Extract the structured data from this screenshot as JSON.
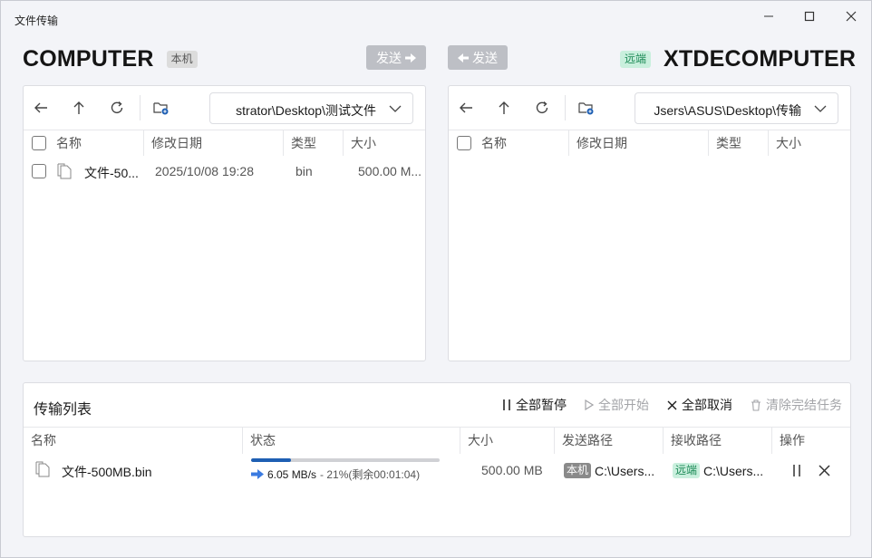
{
  "window": {
    "title": "文件传输"
  },
  "local": {
    "machine_name": "COMPUTER",
    "badge": "本机",
    "send_button": "发送",
    "path": "strator\\Desktop\\测试文件",
    "columns": [
      "名称",
      "修改日期",
      "类型",
      "大小"
    ],
    "files": [
      {
        "name": "文件-50...",
        "modified": "2025/10/08 19:28",
        "type": "bin",
        "size": "500.00 M..."
      }
    ]
  },
  "remote": {
    "machine_name": "XTDECOMPUTER",
    "badge": "远端",
    "send_button": "发送",
    "path": "Jsers\\ASUS\\Desktop\\传输",
    "columns": [
      "名称",
      "修改日期",
      "类型",
      "大小"
    ],
    "files": []
  },
  "transfers": {
    "title": "传输列表",
    "actions": {
      "pause_all": "全部暂停",
      "start_all": "全部开始",
      "cancel_all": "全部取消",
      "clear_done": "清除完结任务"
    },
    "columns": [
      "名称",
      "状态",
      "大小",
      "发送路径",
      "接收路径",
      "操作"
    ],
    "rows": [
      {
        "name": "文件-500MB.bin",
        "progress_percent": 21,
        "speed": "6.05 MB/s",
        "status_detail": " - 21%(剩余00:01:04)",
        "size": "500.00 MB",
        "send_badge": "本机",
        "send_path": "C:\\Users...",
        "recv_badge": "远端",
        "recv_path": "C:\\Users..."
      }
    ]
  },
  "colors": {
    "accent": "#1e5fb3",
    "remote_badge_bg": "#c9efdd",
    "remote_badge_fg": "#1c8a56",
    "disabled_button": "#bdbfc5"
  }
}
